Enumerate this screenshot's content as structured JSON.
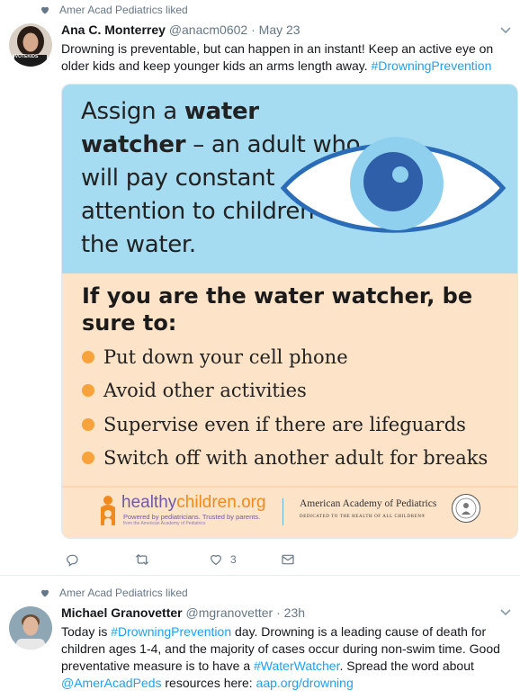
{
  "tweets": [
    {
      "liked_by": "Amer Acad Pediatrics liked",
      "name": "Ana C. Monterrey",
      "handle": "@anacm0602",
      "dot": "·",
      "time": "May 23",
      "text_plain": "Drowning is preventable, but can happen in an instant! Keep an active eye on older kids and keep younger kids an arms length away. ",
      "hashtag": "#DrowningPrevention",
      "avatar_badge": "#VOTEKIDS",
      "reply_count": "",
      "retweet_count": "",
      "like_count": "3"
    },
    {
      "liked_by": "Amer Acad Pediatrics liked",
      "name": "Michael Granovetter",
      "handle": "@mgranovetter",
      "dot": "·",
      "time": "23h",
      "t1": "Today is ",
      "h1": "#DrowningPrevention",
      "t2": " day. Drowning is a leading cause of death for children ages 1-4, and the majority of cases occur during non-swim time. Good preventative measure is to have a ",
      "h2": "#WaterWatcher",
      "t3": ". Spread the word about ",
      "mention": "@AmerAcadPeds",
      "t4": " resources here: ",
      "url": "aap.org/drowning"
    }
  ],
  "infographic": {
    "headline_pre": "Assign a ",
    "headline_bold": "water watcher",
    "headline_post": " – an adult who will pay constant attention to children in the water.",
    "section_head": "If you are the water watcher, be sure to:",
    "bullets": [
      "Put down your cell phone",
      "Avoid other activities",
      "Supervise even if there are lifeguards",
      "Switch off with another adult for breaks"
    ],
    "hc_brand_a": "healthy",
    "hc_brand_b": "children.org",
    "hc_tagline": "Powered by pediatricians. Trusted by parents.",
    "hc_sub": "from the American Academy of Pediatrics",
    "aap_name": "American Academy of Pediatrics",
    "aap_tag": "DEDICATED TO THE HEALTH OF ALL CHILDREN®"
  },
  "colors": {
    "link": "#1da1f2",
    "top_panel": "#a6dcf2",
    "bottom_panel": "#fde3c8",
    "bullet": "#f7a23c",
    "eye_outline": "#2b6cb8"
  },
  "icons": [
    "heart-icon",
    "chevron-down-icon",
    "reply-icon",
    "retweet-icon",
    "like-icon",
    "direct-message-icon"
  ]
}
